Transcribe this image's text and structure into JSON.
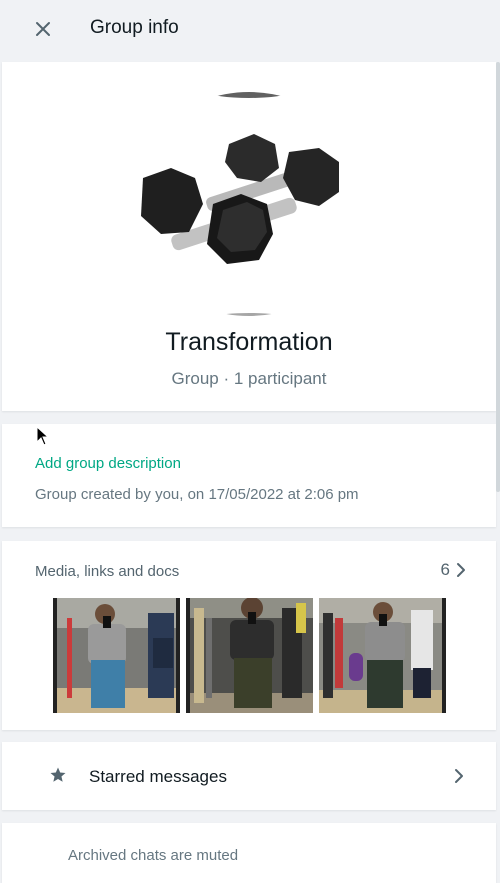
{
  "header": {
    "title": "Group info",
    "close_icon": "close-icon"
  },
  "profile": {
    "name": "Transformation",
    "subtitle": "Group · 1 participant",
    "avatar": "dumbbells-photo"
  },
  "description": {
    "add_label": "Add group description",
    "created_text": "Group created by you, on 17/05/2022 at 2:06 pm"
  },
  "media": {
    "title": "Media, links and docs",
    "count": "6",
    "thumbnails": [
      "gym-mirror-selfie-1",
      "gym-mirror-selfie-2",
      "gym-mirror-selfie-3"
    ]
  },
  "starred": {
    "label": "Starred messages",
    "icon": "star-icon"
  },
  "archived": {
    "text": "Archived chats are muted"
  },
  "colors": {
    "accent": "#00a884",
    "background": "#f0f2f5",
    "card": "#ffffff",
    "primary_text": "#111b21",
    "secondary_text": "#667781",
    "icon": "#54656f"
  }
}
